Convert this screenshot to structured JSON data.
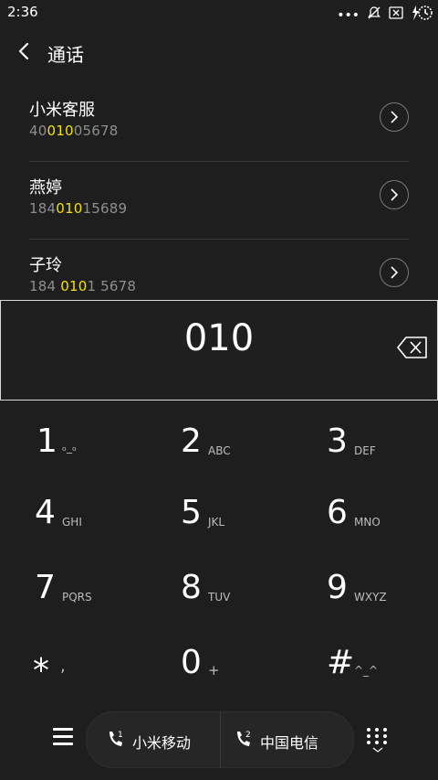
{
  "status": {
    "time": "2:36",
    "icons": [
      "more-dots-icon",
      "bell-off-icon",
      "sim-x-icon",
      "charging-icon"
    ]
  },
  "header": {
    "title": "通话"
  },
  "results": [
    {
      "name": "小米客服",
      "number_pre": "40",
      "number_hl": "010",
      "number_post": "05678"
    },
    {
      "name": "燕婷",
      "number_pre": "184",
      "number_hl": "010",
      "number_post": "15689"
    },
    {
      "name": "子玲",
      "number_pre": "184 ",
      "number_hl": "010",
      "number_post": "1 5678"
    }
  ],
  "input": {
    "digits": "010"
  },
  "keys": [
    {
      "main": "1",
      "sub": "ₒ_ₒ"
    },
    {
      "main": "2",
      "sub": "ABC"
    },
    {
      "main": "3",
      "sub": "DEF"
    },
    {
      "main": "4",
      "sub": "GHI"
    },
    {
      "main": "5",
      "sub": "JKL"
    },
    {
      "main": "6",
      "sub": "MNO"
    },
    {
      "main": "7",
      "sub": "PQRS"
    },
    {
      "main": "8",
      "sub": "TUV"
    },
    {
      "main": "9",
      "sub": "WXYZ"
    },
    {
      "main": "⁎",
      "sub": ","
    },
    {
      "main": "0",
      "sub": "+"
    },
    {
      "main": "#",
      "sub": "^_^"
    }
  ],
  "bottom": {
    "sim1": {
      "label": "小米移动",
      "slot": "1"
    },
    "sim2": {
      "label": "中国电信",
      "slot": "2"
    }
  }
}
